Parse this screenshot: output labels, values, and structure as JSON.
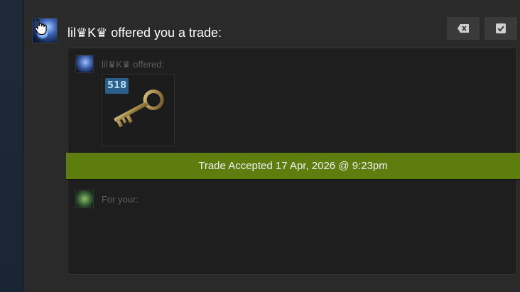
{
  "notification": {
    "title_user": "lil♛K♛",
    "title_suffix": " offered you a trade:"
  },
  "offer": {
    "user": "lil♛K♛",
    "label_suffix": " offered:"
  },
  "item": {
    "quantity": "518",
    "icon": "key-icon"
  },
  "status": {
    "text": "Trade Accepted 17 Apr, 2026 @ 9:23pm",
    "color": "#5d7e0f"
  },
  "request": {
    "label": "For your:"
  },
  "actions": {
    "dismiss_icon": "dismiss-icon",
    "acknowledge_icon": "checkbox-icon"
  }
}
